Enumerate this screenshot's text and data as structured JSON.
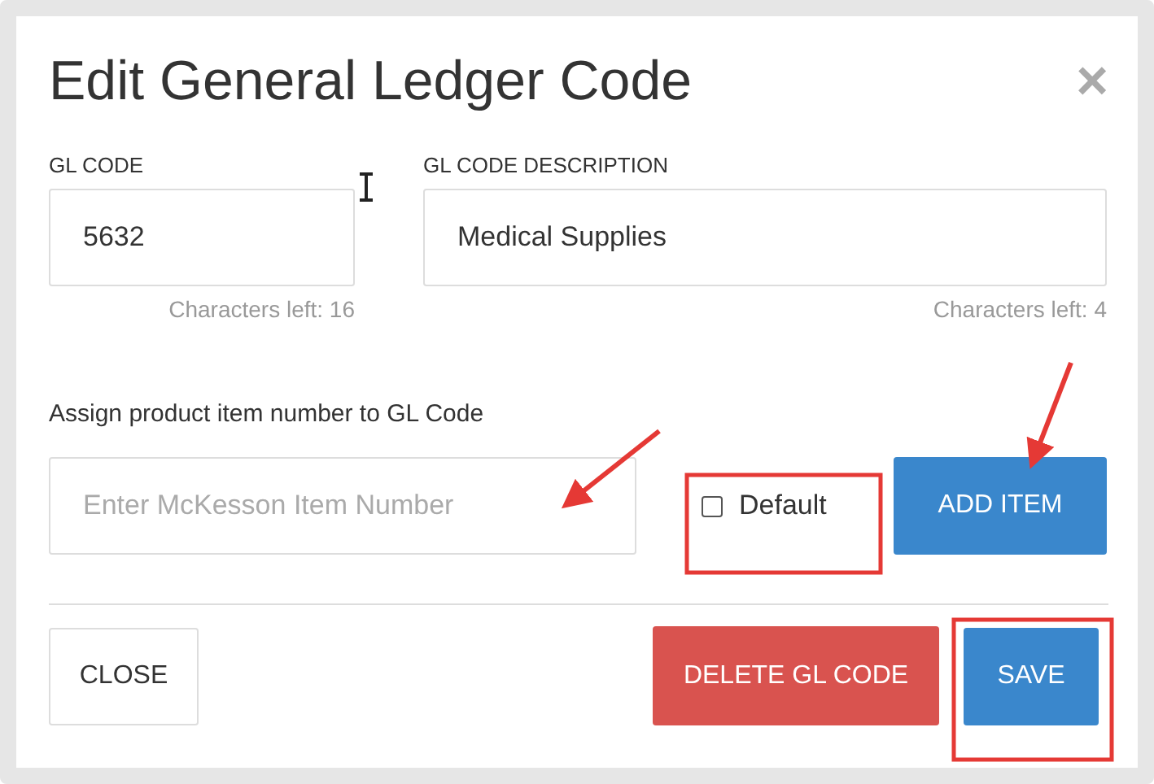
{
  "dialog": {
    "title": "Edit General Ledger Code",
    "close_symbol": "×"
  },
  "gl_code": {
    "label": "GL CODE",
    "value": "5632",
    "counter": "Characters left: 16"
  },
  "description": {
    "label": "GL CODE DESCRIPTION",
    "value": "Medical Supplies",
    "counter": "Characters left: 4"
  },
  "assign_label": "Assign product item number to GL Code",
  "item_field": {
    "placeholder": "Enter McKesson Item Number"
  },
  "default_checkbox": {
    "label": "Default",
    "checked": false
  },
  "add_button": "ADD ITEM",
  "footer_buttons": [
    {
      "label": "CLOSE",
      "kind": "plain"
    },
    {
      "label": "DELETE GL CODE",
      "kind": "danger"
    },
    {
      "label": "SAVE",
      "kind": "primary"
    }
  ]
}
